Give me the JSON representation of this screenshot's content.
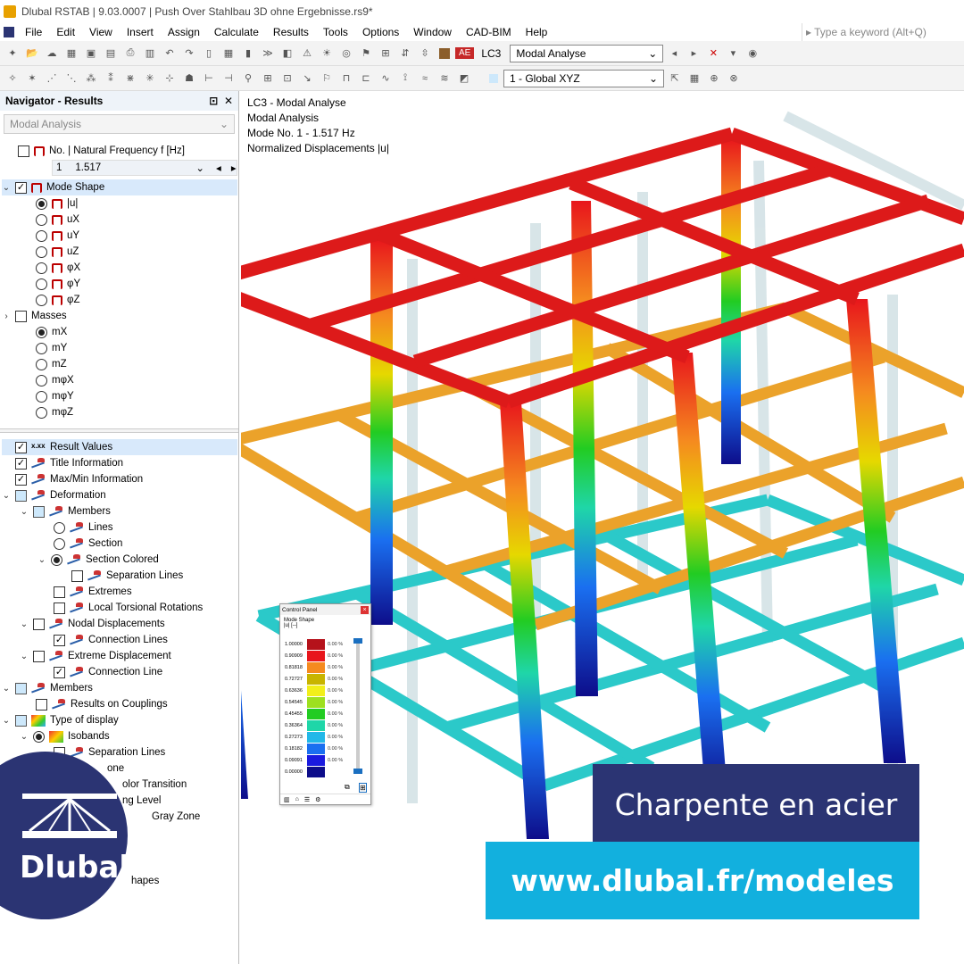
{
  "window": {
    "title": "Dlubal RSTAB | 9.03.0007 | Push Over Stahlbau 3D  ohne Ergebnisse.rs9*"
  },
  "menu": {
    "items": [
      "File",
      "Edit",
      "View",
      "Insert",
      "Assign",
      "Calculate",
      "Results",
      "Tools",
      "Options",
      "Window",
      "CAD-BIM",
      "Help"
    ],
    "search_placeholder": "Type a keyword (Alt+Q)"
  },
  "toolbar": {
    "lc_badge": "AE",
    "lc_id": "LC3",
    "lc_name": "Modal Analyse",
    "coord_system": "1 - Global XYZ"
  },
  "navigator": {
    "title": "Navigator - Results",
    "analysis": "Modal Analysis",
    "freq_header": "No. | Natural Frequency f [Hz]",
    "mode_no": "1",
    "mode_freq": "1.517",
    "mode_shape": "Mode Shape",
    "mode_items": [
      "|u|",
      "uX",
      "uY",
      "uZ",
      "φX",
      "φY",
      "φZ"
    ],
    "masses": "Masses",
    "mass_items": [
      "mX",
      "mY",
      "mZ",
      "mφX",
      "mφY",
      "mφZ"
    ],
    "result_values": "Result Values",
    "title_info": "Title Information",
    "maxmin_info": "Max/Min Information",
    "deformation": "Deformation",
    "members": "Members",
    "lines": "Lines",
    "section": "Section",
    "section_colored": "Section Colored",
    "separation_lines": "Separation Lines",
    "extremes": "Extremes",
    "local_torsional": "Local Torsional Rotations",
    "nodal_displacements": "Nodal Displacements",
    "connection_lines": "Connection Lines",
    "extreme_displacement": "Extreme Displacement",
    "connection_line": "Connection Line",
    "members2": "Members",
    "results_on_couplings": "Results on Couplings",
    "type_of_display": "Type of display",
    "isobands": "Isobands",
    "separation_lines2": "Separation Lines",
    "zone_frag": "one",
    "color_transition_frag": "olor Transition",
    "level_frag": "ng Level",
    "gray_zone_frag": "Gray Zone",
    "shapes_frag": "hapes"
  },
  "viewport": {
    "info_lines": [
      "LC3 - Modal Analyse",
      "Modal Analysis",
      "Mode No. 1 - 1.517 Hz",
      "Normalized Displacements |u|"
    ]
  },
  "control_panel": {
    "title": "Control Panel",
    "subtitle": "Mode Shape",
    "unit": "|u| [--]",
    "legend": [
      {
        "value": "1.00000",
        "color": "#b5121b",
        "pct": "0.00 %"
      },
      {
        "value": "0.90909",
        "color": "#e8161c",
        "pct": "0.00 %"
      },
      {
        "value": "0.81818",
        "color": "#f58a1f",
        "pct": "0.00 %"
      },
      {
        "value": "0.72727",
        "color": "#c8b400",
        "pct": "0.00 %"
      },
      {
        "value": "0.63636",
        "color": "#f2ef1a",
        "pct": "0.00 %"
      },
      {
        "value": "0.54545",
        "color": "#9ee01f",
        "pct": "0.00 %"
      },
      {
        "value": "0.45455",
        "color": "#22cc22",
        "pct": "0.00 %"
      },
      {
        "value": "0.36364",
        "color": "#1fd6a8",
        "pct": "0.00 %"
      },
      {
        "value": "0.27273",
        "color": "#22b8e8",
        "pct": "0.00 %"
      },
      {
        "value": "0.18182",
        "color": "#1a6ff0",
        "pct": "0.00 %"
      },
      {
        "value": "0.09091",
        "color": "#1a1adf",
        "pct": "0.00 %"
      },
      {
        "value": "0.00000",
        "color": "#0d0d8a",
        "pct": ""
      }
    ]
  },
  "banners": {
    "title": "Charpente en acier",
    "url": "www.dlubal.fr/modeles"
  },
  "logo": {
    "text": "Dlubal"
  }
}
